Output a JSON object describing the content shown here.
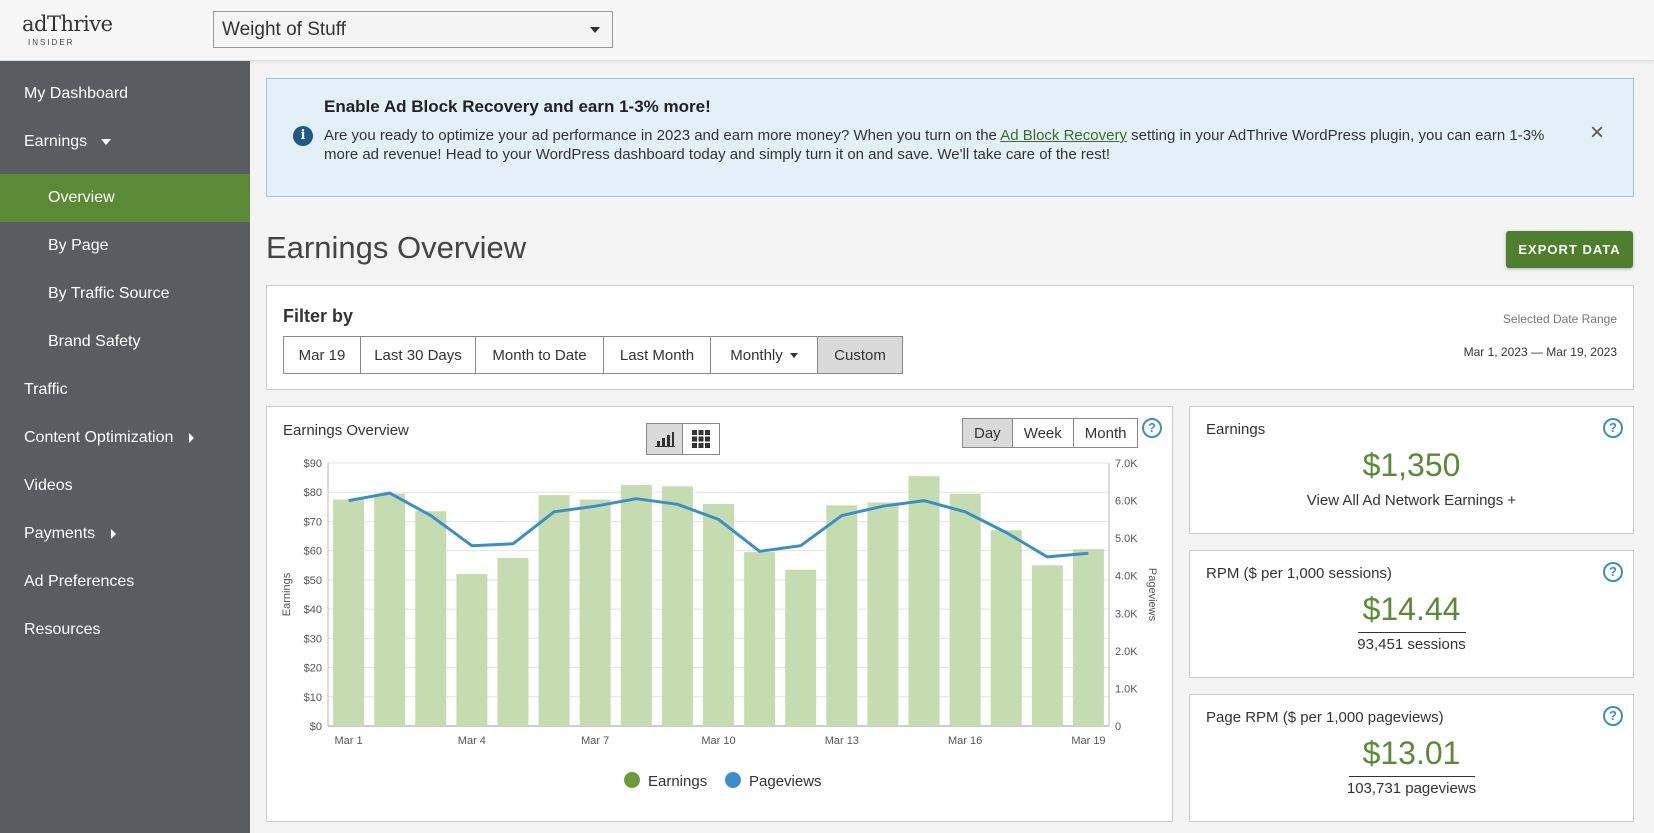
{
  "header": {
    "logo_main": "adThrive",
    "logo_sub": "INSIDER",
    "site_selected": "Weight of Stuff"
  },
  "sidebar": {
    "items": [
      {
        "label": "My Dashboard"
      },
      {
        "label": "Earnings"
      },
      {
        "label": "Overview"
      },
      {
        "label": "By Page"
      },
      {
        "label": "By Traffic Source"
      },
      {
        "label": "Brand Safety"
      },
      {
        "label": "Traffic"
      },
      {
        "label": "Content Optimization"
      },
      {
        "label": "Videos"
      },
      {
        "label": "Payments"
      },
      {
        "label": "Ad Preferences"
      },
      {
        "label": "Resources"
      }
    ]
  },
  "banner": {
    "title": "Enable Ad Block Recovery and earn 1-3% more!",
    "text_before": "Are you ready to optimize your ad performance in 2023 and earn more money? When you turn on the ",
    "link": "Ad Block Recovery",
    "text_after": " setting in your AdThrive WordPress plugin, you can earn 1-3% more ad revenue! Head to your WordPress dashboard today and simply turn it on and save. We'll take care of the rest!"
  },
  "page": {
    "title": "Earnings Overview",
    "export_label": "EXPORT DATA"
  },
  "filter": {
    "title": "Filter by",
    "buttons": [
      {
        "label": "Mar 19"
      },
      {
        "label": "Last 30 Days"
      },
      {
        "label": "Month to Date"
      },
      {
        "label": "Last Month"
      },
      {
        "label": "Monthly"
      },
      {
        "label": "Custom"
      }
    ],
    "selected": "Custom",
    "range_label": "Selected Date Range",
    "range_value": "Mar 1, 2023 — Mar 19, 2023"
  },
  "chart_card": {
    "title": "Earnings Overview",
    "periods": [
      "Day",
      "Week",
      "Month"
    ],
    "period_selected": "Day"
  },
  "chart_data": {
    "type": "bar",
    "categories": [
      "Mar 1",
      "Mar 2",
      "Mar 3",
      "Mar 4",
      "Mar 5",
      "Mar 6",
      "Mar 7",
      "Mar 8",
      "Mar 9",
      "Mar 10",
      "Mar 11",
      "Mar 12",
      "Mar 13",
      "Mar 14",
      "Mar 15",
      "Mar 16",
      "Mar 17",
      "Mar 18",
      "Mar 19"
    ],
    "x_tick_labels": [
      "Mar 1",
      "Mar 4",
      "Mar 7",
      "Mar 10",
      "Mar 13",
      "Mar 16",
      "Mar 19"
    ],
    "x_tick_indices": [
      0,
      3,
      6,
      9,
      12,
      15,
      18
    ],
    "series": [
      {
        "name": "Earnings",
        "type": "bar",
        "axis": "left",
        "color": "#c5dcb0",
        "legend_color": "#6a9a3c",
        "values": [
          77.5,
          79.5,
          73.5,
          52,
          57.5,
          79,
          77.5,
          82.5,
          82,
          76,
          59.5,
          53.5,
          75.5,
          76.5,
          85.5,
          79.5,
          67,
          55,
          60.5
        ]
      },
      {
        "name": "Pageviews",
        "type": "line",
        "axis": "right",
        "color": "#3a8fc8",
        "legend_color": "#3a8fc8",
        "values": [
          6000,
          6200,
          5600,
          4800,
          4850,
          5700,
          5850,
          6050,
          5900,
          5500,
          4650,
          4800,
          5600,
          5850,
          6000,
          5700,
          5150,
          4500,
          4600
        ]
      }
    ],
    "y_left": {
      "label": "Earnings",
      "min": 0,
      "max": 90,
      "ticks": [
        "$0",
        "$10",
        "$20",
        "$30",
        "$40",
        "$50",
        "$60",
        "$70",
        "$80",
        "$90"
      ]
    },
    "y_right": {
      "label": "Pageviews",
      "min": 0,
      "max": 7000,
      "ticks": [
        "0",
        "1.0K",
        "2.0K",
        "3.0K",
        "4.0K",
        "5.0K",
        "6.0K",
        "7.0K"
      ]
    },
    "grid": true,
    "legend_position": "bottom"
  },
  "stats": [
    {
      "label": "Earnings",
      "value": "$1,350",
      "sub": "View All Ad Network Earnings +"
    },
    {
      "label": "RPM ($ per 1,000 sessions)",
      "value": "$14.44",
      "sub": "93,451 sessions"
    },
    {
      "label": "Page RPM ($ per 1,000 pageviews)",
      "value": "$13.01",
      "sub": "103,731 pageviews"
    }
  ]
}
